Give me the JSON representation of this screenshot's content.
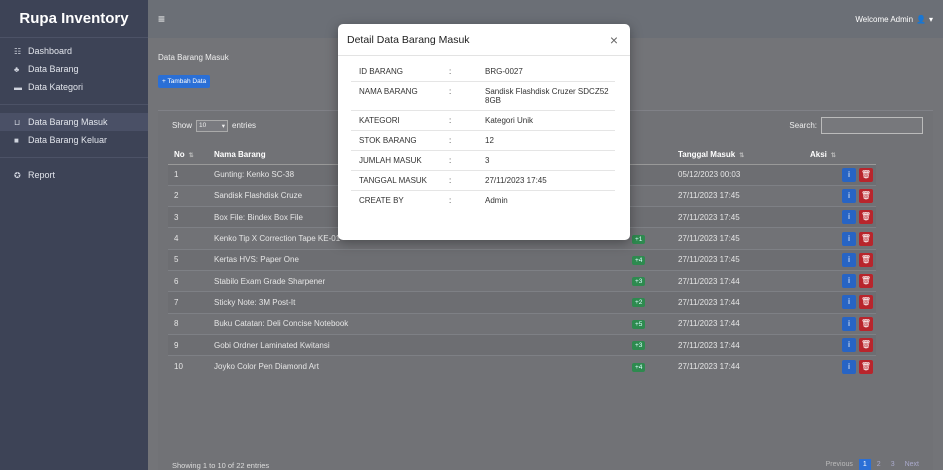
{
  "sidebar": {
    "brand": "Rupa Inventory",
    "items": [
      {
        "label": "Dashboard",
        "icon": "grid-icon",
        "glyph": "☷"
      },
      {
        "label": "Data Barang",
        "icon": "users-icon",
        "glyph": "♣"
      },
      {
        "label": "Data Kategori",
        "icon": "tags-icon",
        "glyph": "▬"
      }
    ],
    "items2": [
      {
        "label": "Data Barang Masuk",
        "icon": "box-in-icon",
        "glyph": "⊔"
      },
      {
        "label": "Data Barang Keluar",
        "icon": "truck-icon",
        "glyph": "■"
      }
    ],
    "items3": [
      {
        "label": "Report",
        "icon": "report-icon",
        "glyph": "✪"
      }
    ]
  },
  "topbar": {
    "menu_glyph": "≡",
    "welcome": "Welcome Admin",
    "user_glyph": "👤",
    "caret": "▾"
  },
  "page": {
    "breadcrumb": "Data Barang Masuk",
    "add_button": "+ Tambah Data",
    "show_label": "Show",
    "length_value": "10",
    "entries_label": "entries",
    "search_label": "Search:"
  },
  "table": {
    "headers": [
      "No",
      "Nama Barang",
      "h",
      "Tanggal Masuk",
      "Aksi"
    ],
    "rows": [
      {
        "no": "1",
        "nama": "Gunting: Kenko SC-38",
        "jumlah": "",
        "tanggal": "05/12/2023 00:03"
      },
      {
        "no": "2",
        "nama": "Sandisk Flashdisk Cruze",
        "jumlah": "",
        "tanggal": "27/11/2023 17:45"
      },
      {
        "no": "3",
        "nama": "Box File: Bindex Box File",
        "jumlah": "",
        "tanggal": "27/11/2023 17:45"
      },
      {
        "no": "4",
        "nama": "Kenko Tip X Correction Tape KE-01",
        "jumlah": "+1",
        "tanggal": "27/11/2023 17:45"
      },
      {
        "no": "5",
        "nama": "Kertas HVS: Paper One",
        "jumlah": "+4",
        "tanggal": "27/11/2023 17:45"
      },
      {
        "no": "6",
        "nama": "Stabilo Exam Grade Sharpener",
        "jumlah": "+3",
        "tanggal": "27/11/2023 17:44"
      },
      {
        "no": "7",
        "nama": "Sticky Note: 3M Post-It",
        "jumlah": "+2",
        "tanggal": "27/11/2023 17:44"
      },
      {
        "no": "8",
        "nama": "Buku Catatan: Deli Concise Notebook",
        "jumlah": "+5",
        "tanggal": "27/11/2023 17:44"
      },
      {
        "no": "9",
        "nama": "Gobi Ordner Laminated Kwitansi",
        "jumlah": "+3",
        "tanggal": "27/11/2023 17:44"
      },
      {
        "no": "10",
        "nama": "Joyko Color Pen Diamond Art",
        "jumlah": "+4",
        "tanggal": "27/11/2023 17:44"
      }
    ],
    "info_glyph": "i",
    "delete_glyph": "🗑"
  },
  "footer": {
    "info": "Showing 1 to 10 of 22 entries",
    "pagination": [
      "Previous",
      "1",
      "2",
      "3",
      "Next"
    ]
  },
  "modal": {
    "title": "Detail Data Barang Masuk",
    "close": "×",
    "rows": [
      {
        "label": "ID BARANG",
        "sep": ":",
        "value": "BRG-0027"
      },
      {
        "label": "NAMA BARANG",
        "sep": ":",
        "value": "Sandisk Flashdisk Cruzer SDCZ52 8GB"
      },
      {
        "label": "KATEGORI",
        "sep": ":",
        "value": "Kategori Unik"
      },
      {
        "label": "STOK BARANG",
        "sep": ":",
        "value": "12"
      },
      {
        "label": "JUMLAH MASUK",
        "sep": ":",
        "value": "3"
      },
      {
        "label": "TANGGAL MASUK",
        "sep": ":",
        "value": "27/11/2023 17:45"
      },
      {
        "label": "CREATE BY",
        "sep": ":",
        "value": "Admin"
      }
    ]
  },
  "colors": {
    "sidebar": "#3d4356",
    "primary": "#2a6fd6",
    "danger": "#b8252c",
    "success": "#2e8a4f"
  }
}
